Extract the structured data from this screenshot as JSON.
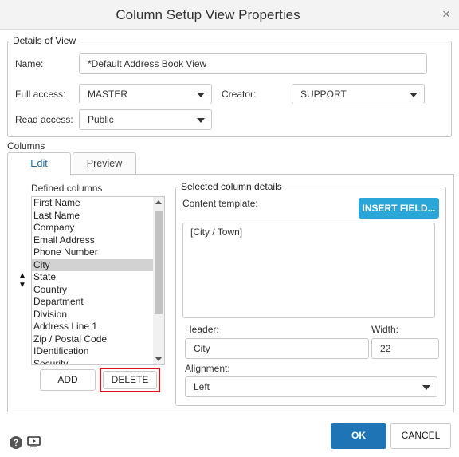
{
  "dialog": {
    "title": "Column Setup View Properties",
    "close_symbol": "×"
  },
  "details": {
    "legend": "Details of View",
    "name_label": "Name:",
    "name_value": "*Default Address Book View",
    "full_access_label": "Full access:",
    "full_access_value": "MASTER",
    "creator_label": "Creator:",
    "creator_value": "SUPPORT",
    "read_access_label": "Read access:",
    "read_access_value": "Public"
  },
  "columns": {
    "label": "Columns",
    "tabs": [
      {
        "label": "Edit",
        "active": true
      },
      {
        "label": "Preview",
        "active": false
      }
    ],
    "defined_label": "Defined columns",
    "items": [
      "First Name",
      "Last Name",
      "Company",
      "Email Address",
      "Phone Number",
      "City",
      "State",
      "Country",
      "Department",
      "Division",
      "Address Line 1",
      "Zip / Postal Code",
      "IDentification",
      "Security"
    ],
    "selected_item": "City",
    "move_up_symbol": "▲",
    "move_down_symbol": "▼",
    "add_label": "ADD",
    "delete_label": "DELETE"
  },
  "selected_details": {
    "legend": "Selected column details",
    "content_template_label": "Content template:",
    "insert_field_label": "INSERT FIELD...",
    "template_value": "[City / Town]",
    "header_label": "Header:",
    "header_value": "City",
    "width_label": "Width:",
    "width_value": "22",
    "alignment_label": "Alignment:",
    "alignment_value": "Left"
  },
  "footer": {
    "ok_label": "OK",
    "cancel_label": "CANCEL"
  },
  "colors": {
    "primary": "#1f74b5",
    "insert": "#2aa6d8",
    "highlight": "#d9121f",
    "selected_row": "#d2d2d2"
  }
}
